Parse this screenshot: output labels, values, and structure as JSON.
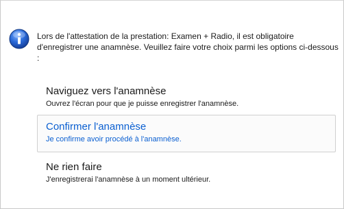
{
  "dialog": {
    "message_lines": [
      "Lors de l'attestation de la prestation: Examen + Radio, il est obligatoire",
      "d'enregistrer une anamnèse. Veuillez faire votre choix parmi les options ci-dessous",
      ":"
    ],
    "icon": "info-icon",
    "options": [
      {
        "title": "Naviguez vers l'anamnèse",
        "description": "Ouvrez l'écran pour que je puisse enregistrer l'anamnèse."
      },
      {
        "title": "Confirmer l'anamnèse",
        "description": "Je confirme avoir procédé à l'anamnèse."
      },
      {
        "title": "Ne rien faire",
        "description": "J'enregistrerai l'anamnèse à un moment ultérieur."
      }
    ],
    "selected_option_index": 1
  },
  "colors": {
    "selected_text": "#0a5fd1",
    "icon_blue": "#1b5fc8"
  }
}
